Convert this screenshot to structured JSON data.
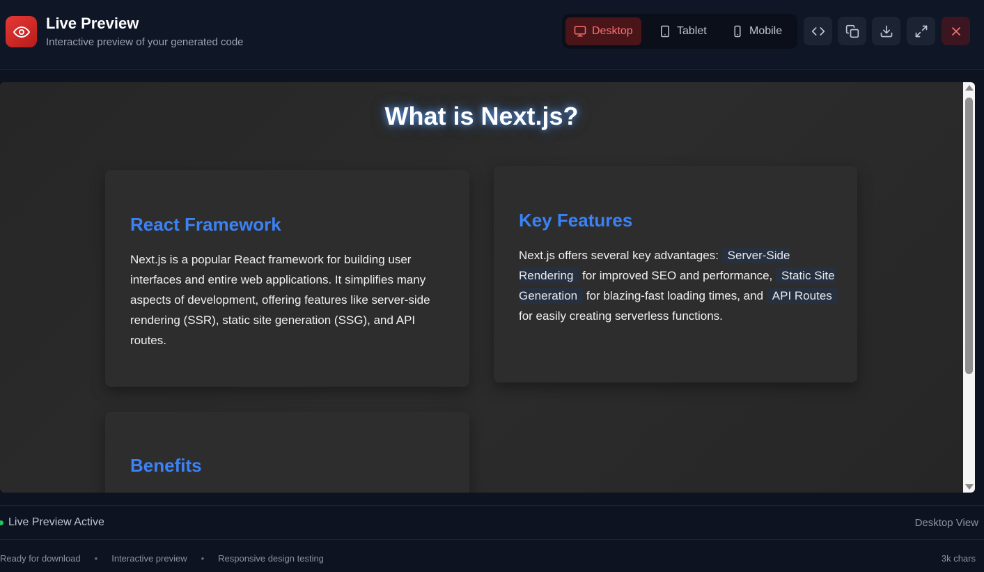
{
  "header": {
    "title": "Live Preview",
    "subtitle": "Interactive preview of your generated code",
    "icon": "eye-icon",
    "accent": "#e53935"
  },
  "device_modes": {
    "selected": "Desktop",
    "items": [
      {
        "label": "Desktop",
        "icon": "monitor-icon"
      },
      {
        "label": "Tablet",
        "icon": "tablet-icon"
      },
      {
        "label": "Mobile",
        "icon": "smartphone-icon"
      }
    ]
  },
  "toolbar": {
    "buttons": [
      "code-icon",
      "copy-icon",
      "download-icon",
      "fullscreen-icon",
      "close-icon"
    ]
  },
  "preview": {
    "heading": "What is Next.js?",
    "cards": [
      {
        "title": "React Framework",
        "body": "Next.js is a popular React framework for building user interfaces and entire web applications. It simplifies many aspects of development, offering features like server-side rendering (SSR), static site generation (SSG), and API routes."
      },
      {
        "title": "Key Features",
        "body_parts": [
          "Next.js offers several key advantages: ",
          "Server-Side Rendering",
          " for improved SEO and performance, ",
          "Static Site Generation",
          " for blazing-fast loading times, and ",
          "API Routes",
          " for easily creating serverless functions."
        ]
      },
      {
        "title": "Benefits"
      }
    ]
  },
  "status": {
    "text": "Live Preview Active",
    "view": "Desktop View",
    "dot_color": "#22c55e"
  },
  "footer": {
    "items": [
      "Ready for download",
      "Interactive preview",
      "Responsive design testing"
    ],
    "separator": "•",
    "size": "3k chars"
  }
}
